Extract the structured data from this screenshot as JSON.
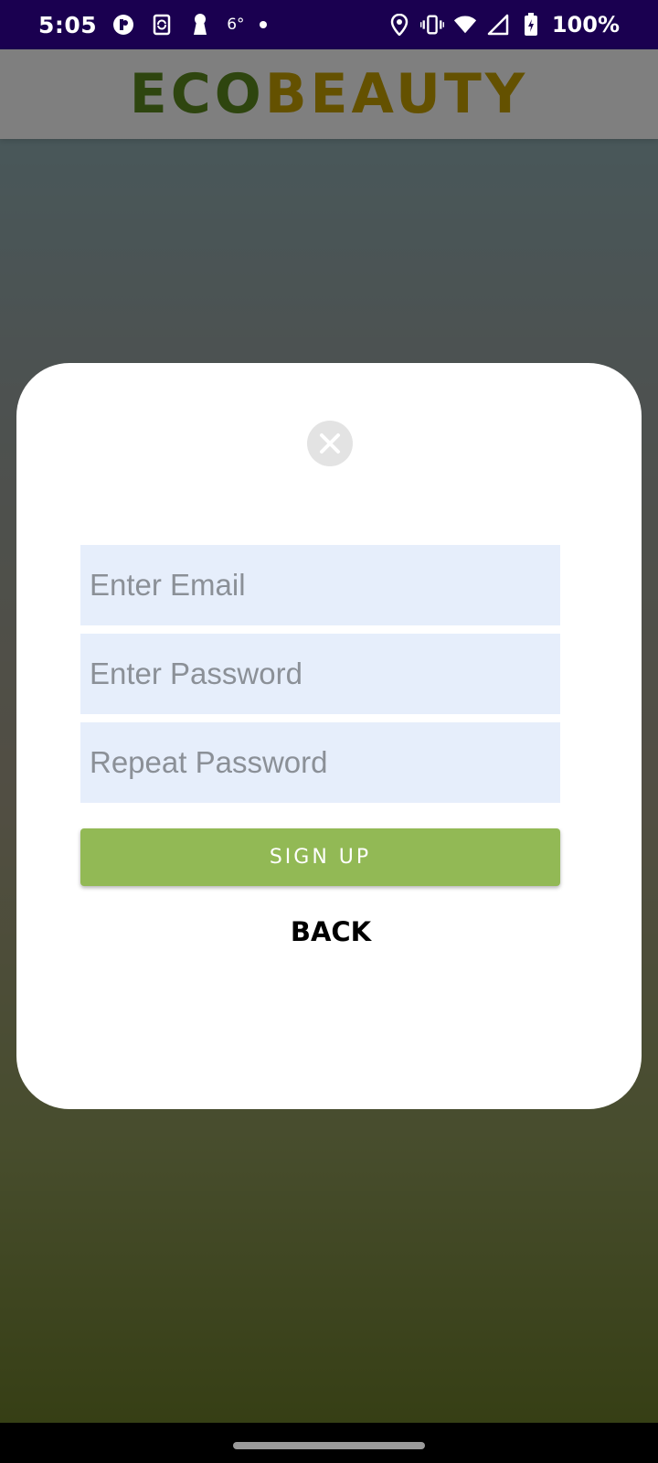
{
  "status_bar": {
    "time": "5:05",
    "temperature": "6°",
    "battery": "100%",
    "icons_left": [
      "notification-app-icon",
      "sync-icon",
      "keyhole-icon"
    ],
    "icons_right": [
      "location-icon",
      "vibrate-icon",
      "wifi-icon",
      "signal-icon",
      "battery-charging-icon"
    ]
  },
  "header": {
    "logo_part1": "ECO",
    "logo_part2": "BEAUTY"
  },
  "dialog": {
    "email_placeholder": "Enter Email",
    "password_placeholder": "Enter Password",
    "repeat_password_placeholder": "Repeat Password",
    "signup_label": "SIGN UP",
    "back_label": "BACK",
    "close_icon": "close-icon"
  },
  "colors": {
    "accent_green": "#92b955",
    "field_background": "#e6eefb",
    "status_bar": "#1a0050"
  }
}
